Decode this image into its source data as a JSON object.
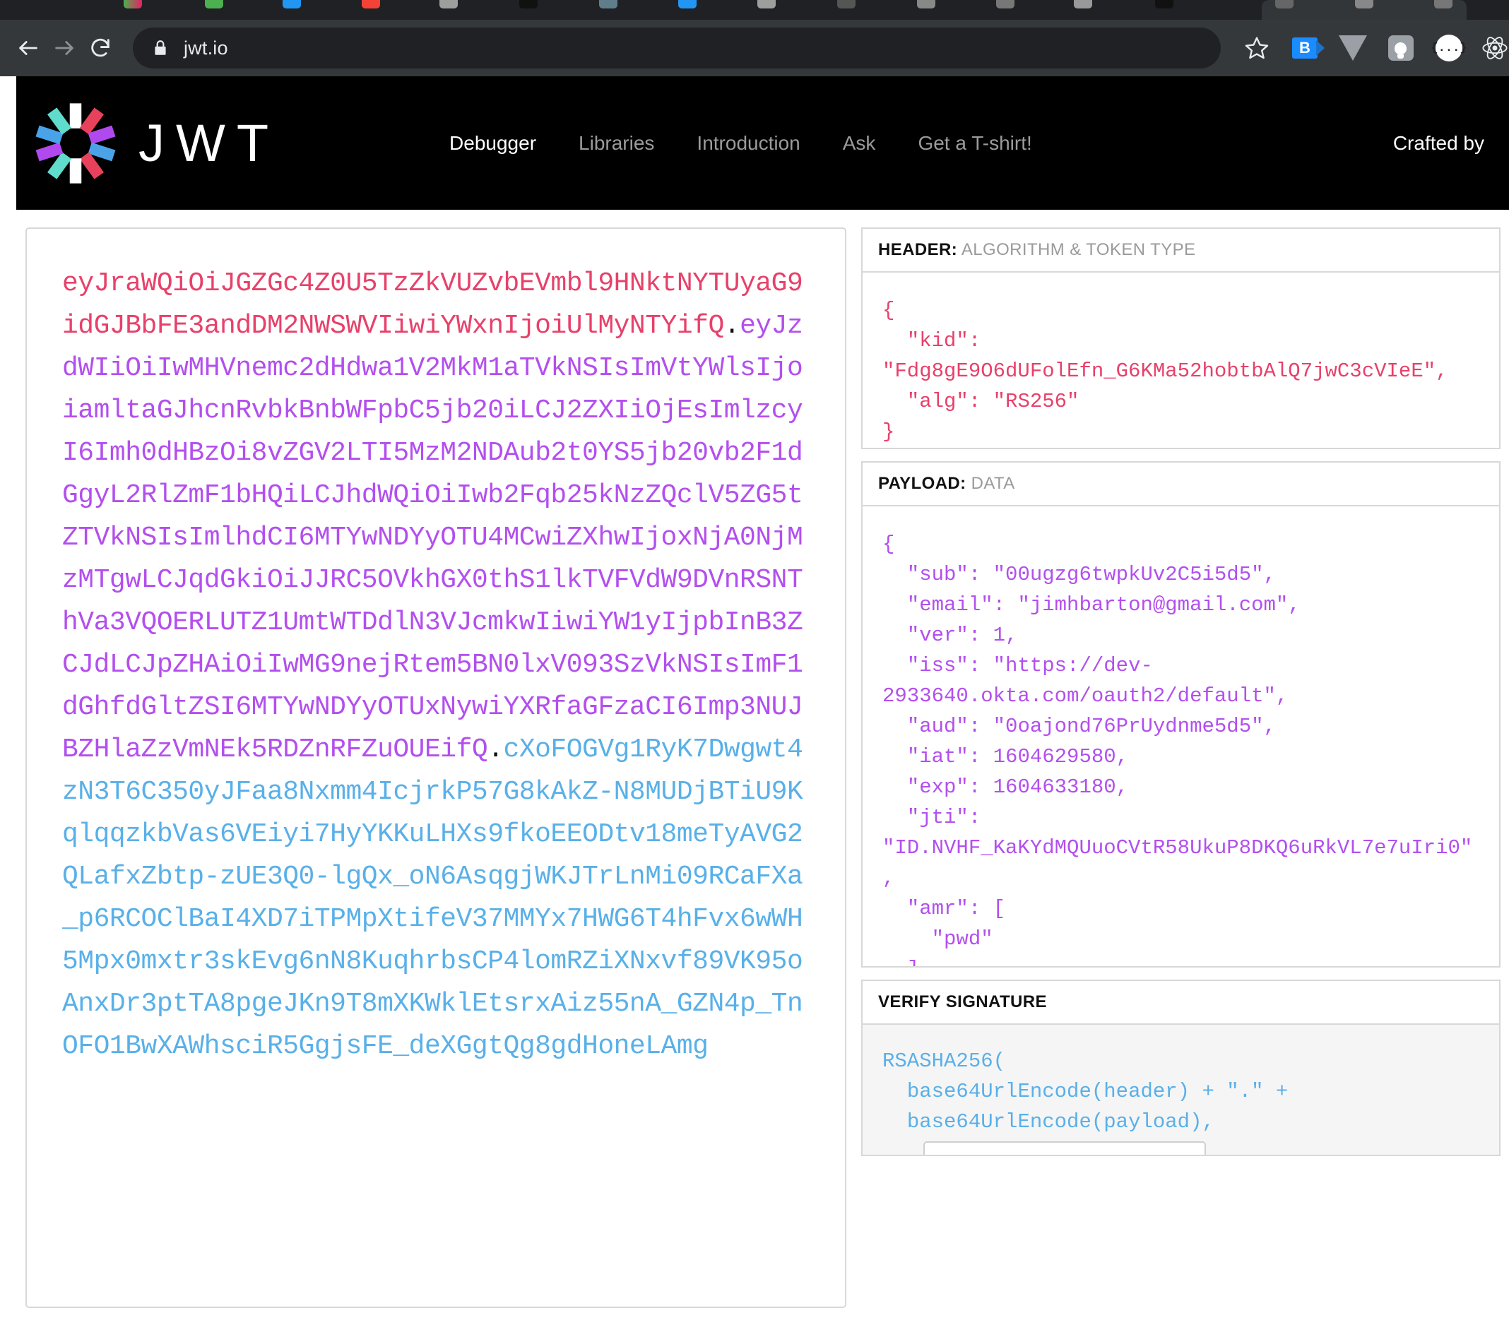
{
  "browser": {
    "url": "jwt.io",
    "back_label": "Back",
    "forward_label": "Forward",
    "reload_label": "Reload",
    "bookmark_label": "Bookmark this tab",
    "extensions": [
      {
        "name": "bandicam-recorder-extension",
        "label": "B"
      },
      {
        "name": "vue-devtools-extension",
        "label": ""
      },
      {
        "name": "lightbulb-extension",
        "label": ""
      },
      {
        "name": "json-formatter-extension",
        "label": "{...}"
      },
      {
        "name": "react-devtools-extension",
        "label": ""
      }
    ]
  },
  "site": {
    "logo_text": "JWT",
    "nav": [
      {
        "label": "Debugger",
        "active": true
      },
      {
        "label": "Libraries",
        "active": false
      },
      {
        "label": "Introduction",
        "active": false
      },
      {
        "label": "Ask",
        "active": false
      },
      {
        "label": "Get a T-shirt!",
        "active": false
      }
    ],
    "crafted_by": "Crafted by"
  },
  "encoded": {
    "header_part": "eyJraWQiOiJGZGc4Z0U5TzZkVUZvbEVmbl9HNktNYTUyaG9idGJBbFE3andDM2NWSWVIiwiYWxnIjoiUlMyNTYifQ",
    "payload_part": "eyJzdWIiOiIwMHVnemc2dHdwa1V2MkM1aTVkNSIsImVtYWlsIjoiamltaGJhcnRvbkBnbWFpbC5jb20iLCJ2ZXIiOjEsImlzcyI6Imh0dHBzOi8vZGV2LTI5MzM2NDAub2t0YS5jb20vb2F1dGgyL2RlZmF1bHQiLCJhdWQiOiIwb2Fqb25kNzZQclV5ZG5tZTVkNSIsImlhdCI6MTYwNDYyOTU4MCwiZXhwIjoxNjA0NjMzMTgwLCJqdGkiOiJJRC5OVkhGX0thS1lkTVFVdW9DVnRSNThVa3VQOERLUTZ1UmtWTDdlN3VJcmkwIiwiYW1yIjpbInB3ZCJdLCJpZHAiOiIwMG9nejRtem5BN0lxV093SzVkNSIsImF1dGhfdGltZSI6MTYwNDYyOTUxNywiYXRfaGFzaCI6Imp3NUJBZHlaZzVmNEk5RDZnRFZuOUEifQ",
    "signature_part": "cXoFOGVg1RyK7Dwgwt4zN3T6C350yJFaa8Nxmm4IcjrkP57G8kAkZ-N8MUDjBTiU9KqlqqzkbVas6VEiyi7HyYKKuLHXs9fkoEEODtv18meTyAVG2QLafxZbtp-zUE3Q0-lgQx_oN6AsqgjWKJTrLnMi09RCaFXa_p6RCOClBaI4XD7iTPMpXtifeV37MMYx7HWG6T4hFvx6wWH5Mpx0mxtr3skEvg6nN8KuqhrbsCP4lomRZiXNxvf89VK95oAnxDr3ptTA8pgeJKn9T8mXKWklEtsrxAiz55nA_GZN4p_TnOFO1BwXAWhsciR5GgjsFE_deXGgtQg8gdHoneLAmg",
    "dot": "."
  },
  "decoded": {
    "header": {
      "title_strong": "HEADER:",
      "title_sub": "ALGORITHM & TOKEN TYPE",
      "json": "{\n  \"kid\": \"Fdg8gE9O6dUFolEfn_G6KMa52hobtbAlQ7jwC3cVIeE\",\n  \"alg\": \"RS256\"\n}"
    },
    "payload": {
      "title_strong": "PAYLOAD:",
      "title_sub": "DATA",
      "json": "{\n  \"sub\": \"00ugzg6twpkUv2C5i5d5\",\n  \"email\": \"jimhbarton@gmail.com\",\n  \"ver\": 1,\n  \"iss\": \"https://dev-2933640.okta.com/oauth2/default\",\n  \"aud\": \"0oajond76PrUydnme5d5\",\n  \"iat\": 1604629580,\n  \"exp\": 1604633180,\n  \"jti\": \"ID.NVHF_KaKYdMQUuoCVtR58UkuP8DKQ6uRkVL7e7uIri0\",\n  \"amr\": [\n    \"pwd\"\n  ],\n  \"idp\": \"00ogz4mznA7IqWOwK5d5\",\n  \"auth_time\": 1604629517,\n  \"at_hash\": \"jw5BAdyZg5f4I9D6gDVn9A\"\n}"
    },
    "signature": {
      "title_strong": "VERIFY SIGNATURE",
      "title_sub": "",
      "code": "RSASHA256(\n  base64UrlEncode(header) + \".\" +\n  base64UrlEncode(payload),"
    }
  },
  "colors": {
    "header_color": "#e7416a",
    "payload_color": "#b34fee",
    "signature_color": "#59b0e8",
    "site_bg": "#000000",
    "chrome_bg": "#323639"
  }
}
